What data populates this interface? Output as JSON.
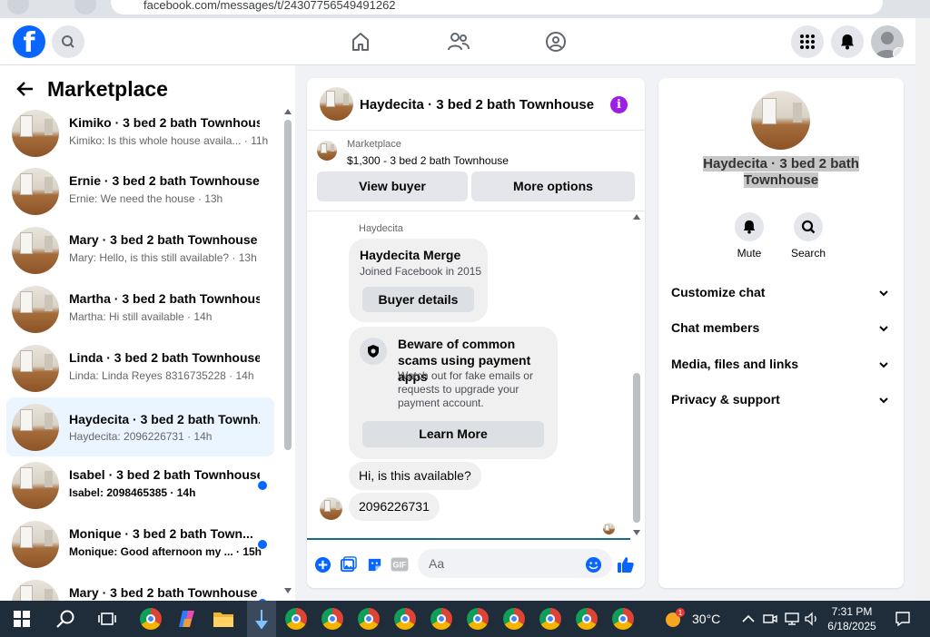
{
  "browser": {
    "url": "facebook.com/messages/t/24307756549491262"
  },
  "colors": {
    "fb_blue": "#0866ff",
    "active_row": "#ebf5ff",
    "info_purple": "#9d1ee6",
    "unread_dot": "#0866ff"
  },
  "topbar": {
    "logo": "f"
  },
  "left": {
    "title": "Marketplace",
    "conversations": [
      {
        "name": "Kimiko · 3 bed 2 bath Townhouse",
        "preview": "Kimiko: Is this whole house availa... · 11h",
        "unread": false,
        "active": false
      },
      {
        "name": "Ernie · 3 bed 2 bath Townhouse",
        "preview": "Ernie: We need the house · 13h",
        "unread": false,
        "active": false
      },
      {
        "name": "Mary · 3 bed 2 bath Townhouse",
        "preview": "Mary: Hello, is this still available? · 13h",
        "unread": false,
        "active": false
      },
      {
        "name": "Martha · 3 bed 2 bath Townhouse",
        "preview": "Martha: Hi still available · 14h",
        "unread": false,
        "active": false
      },
      {
        "name": "Linda · 3 bed 2 bath Townhouse",
        "preview": "Linda: Linda Reyes 8316735228 · 14h",
        "unread": false,
        "active": false
      },
      {
        "name": "Haydecita · 3 bed 2 bath Townh...",
        "preview": "Haydecita: 2096226731 · 14h",
        "unread": false,
        "active": true
      },
      {
        "name": "Isabel · 3 bed 2 bath Townhouse",
        "preview": "Isabel: 2098465385 · 14h",
        "unread": true,
        "active": false
      },
      {
        "name": "Monique · 3 bed 2 bath Town...",
        "preview": "Monique: Good afternoon my ... · 15h",
        "unread": true,
        "active": false
      },
      {
        "name": "Mary · 3 bed 2 bath Townhouse",
        "preview": "",
        "unread": true,
        "active": false
      }
    ]
  },
  "chat": {
    "title": "Haydecita · 3 bed 2 bath Townhouse",
    "listing": {
      "source": "Marketplace",
      "price_title": "$1,300 - 3 bed 2 bath Townhouse"
    },
    "view_buyer": "View buyer",
    "more_options": "More options",
    "sender": "Haydecita",
    "buyer_card": {
      "name": "Haydecita Merge",
      "joined": "Joined Facebook in 2015",
      "button": "Buyer details"
    },
    "scam_card": {
      "title": "Beware of common scams using payment apps",
      "body": "Watch out for fake emails or requests to upgrade your payment account.",
      "button": "Learn More"
    },
    "messages": [
      "Hi, is this available?",
      "2096226731"
    ],
    "composer_placeholder": "Aa"
  },
  "info": {
    "name": "Haydecita · 3 bed 2 bath Townhouse",
    "actions": [
      {
        "label": "Mute",
        "icon": "bell-icon"
      },
      {
        "label": "Search",
        "icon": "search-icon"
      }
    ],
    "sections": [
      "Customize chat",
      "Chat members",
      "Media, files and links",
      "Privacy & support"
    ]
  },
  "taskbar": {
    "weather_badge": "1",
    "temperature": "30°C",
    "time": "7:31 PM",
    "date": "6/18/2025"
  }
}
